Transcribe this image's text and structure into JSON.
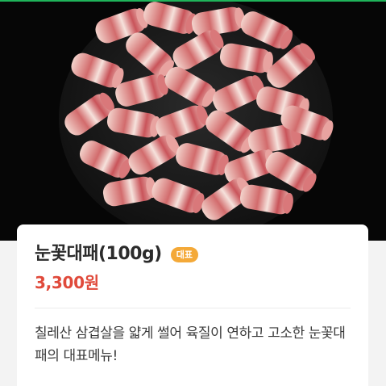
{
  "menu_item": {
    "image_alt": "sliced pork belly rolls on a black plate",
    "name": "눈꽃대패(100g)",
    "badge": "대표",
    "price": "3,300원",
    "description": "칠레산 삼겹살을 얇게 썰어 육질이 연하고 고소한 눈꽃대패의 대표메뉴!"
  },
  "colors": {
    "accent_bar": "#1fb45a",
    "badge": "#f4a938",
    "price": "#e04a3b"
  }
}
